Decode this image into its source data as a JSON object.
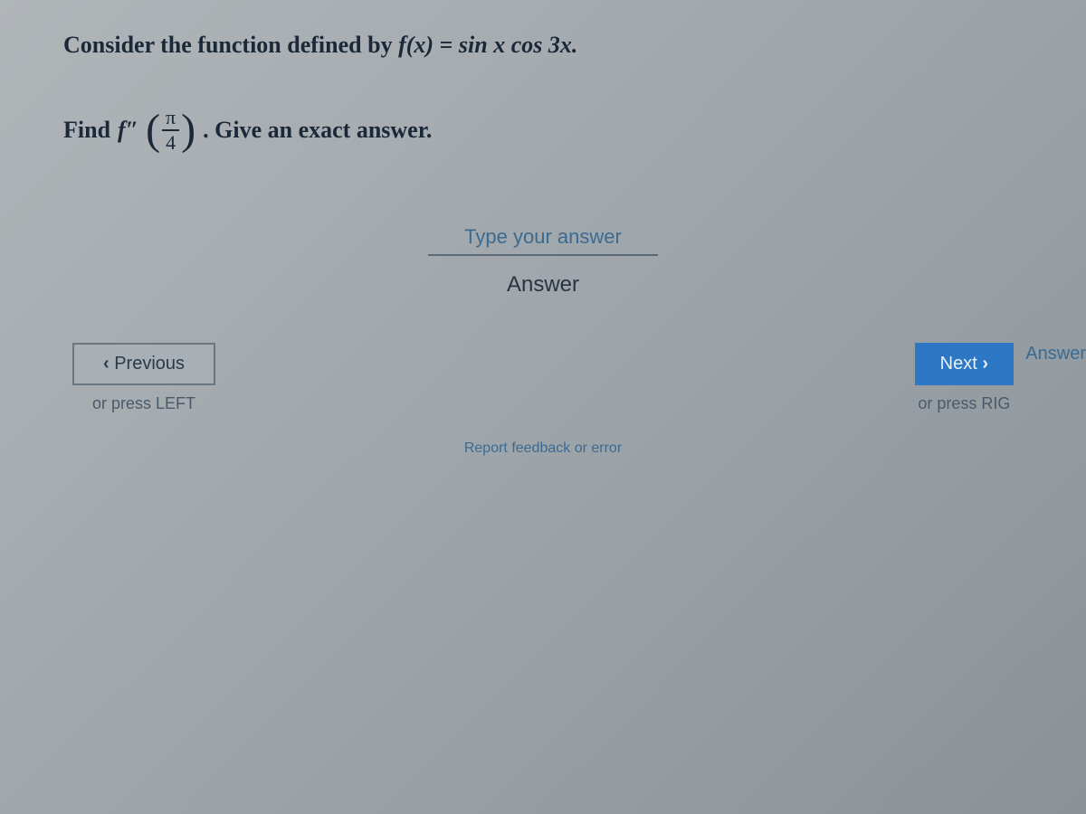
{
  "problem": {
    "intro_prefix": "Consider the function defined by ",
    "function_lhs": "f(x)",
    "equals": " = ",
    "function_rhs": "sin x cos 3x.",
    "find_prefix": "Find ",
    "f_double_prime": "f″",
    "fraction_num": "π",
    "fraction_den": "4",
    "find_suffix": ". Give an exact answer."
  },
  "answer_box": {
    "label": "Type your answer",
    "sublabel": "Answer"
  },
  "side_label": "Answer",
  "nav": {
    "prev_label": "Previous",
    "prev_hint": "or press LEFT",
    "next_label": "Next",
    "next_hint": "or press RIG"
  },
  "report_link": "Report feedback or error"
}
